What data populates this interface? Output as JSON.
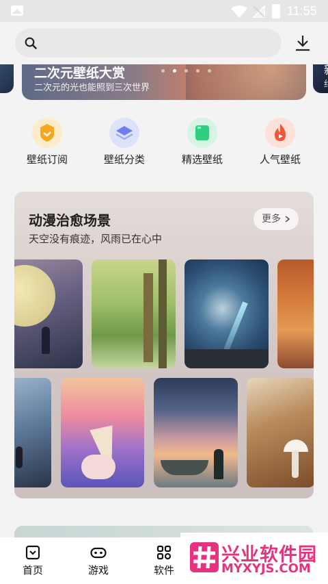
{
  "status_bar": {
    "time": "11:55",
    "icons": [
      "image-icon",
      "wifi-icon",
      "no-signal-icon",
      "battery-charging-icon"
    ]
  },
  "search": {
    "placeholder": ""
  },
  "banner": {
    "title": "二次元壁纸大赏",
    "subtitle": "二次元的光也能照到三次世界",
    "side_title": "新",
    "side_sub": "约",
    "active_dot": 1,
    "dot_count": 5
  },
  "categories": [
    {
      "label": "壁纸订阅",
      "icon": "subscribe-badge-icon",
      "color": "#f5a623"
    },
    {
      "label": "壁纸分类",
      "icon": "layers-icon",
      "color": "#6f7df0"
    },
    {
      "label": "精选壁纸",
      "icon": "featured-card-icon",
      "color": "#2ecf7f"
    },
    {
      "label": "人气壁纸",
      "icon": "flame-icon",
      "color": "#f0573a"
    }
  ],
  "section": {
    "title": "动漫治愈场景",
    "subtitle": "天空没有痕迹，风雨已在心中",
    "more_label": "更多"
  },
  "tabbar": {
    "items": [
      {
        "label": "首页",
        "icon": "home-icon"
      },
      {
        "label": "游戏",
        "icon": "gamepad-icon"
      },
      {
        "label": "软件",
        "icon": "apps-icon"
      }
    ]
  },
  "watermark": {
    "cn": "兴业软件园",
    "en": "MYXYJS.COM"
  },
  "colors": {
    "brand_pink": "#e8327f",
    "card_bg": "#d8cdca"
  }
}
